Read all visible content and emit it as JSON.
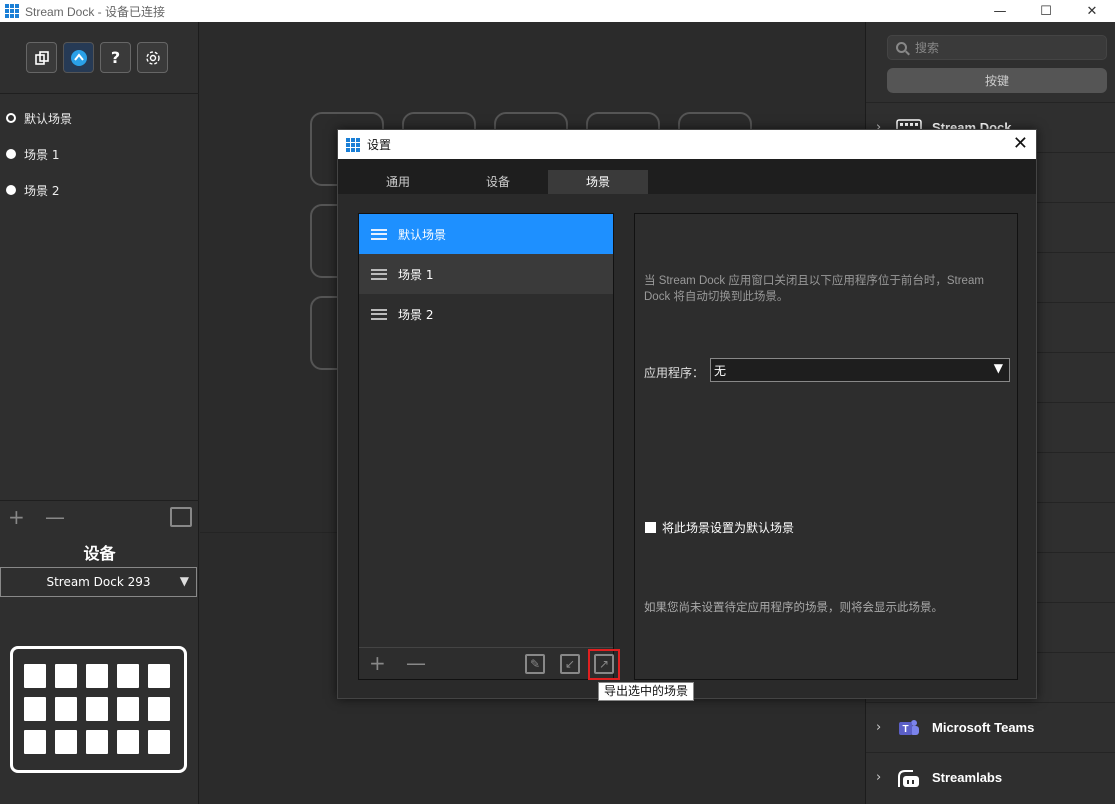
{
  "window": {
    "title": "Stream Dock - 设备已连接",
    "minimize": "—",
    "maximize": "☐",
    "close": "✕"
  },
  "toolbar": {
    "help_label": "?"
  },
  "scenes": [
    {
      "label": "默认场景",
      "active": true
    },
    {
      "label": "场景 1",
      "active": false
    },
    {
      "label": "场景 2",
      "active": false
    }
  ],
  "left_bottom": {
    "add": "+",
    "remove": "—"
  },
  "device": {
    "title": "设备",
    "selected": "Stream Dock 293",
    "key_rows": 3,
    "key_cols": 5
  },
  "right": {
    "search_placeholder": "搜索",
    "key_button": "按键",
    "categories": [
      {
        "label": "Stream Dock",
        "icon": "keyboard-icon"
      },
      {
        "label": "Microsoft Teams",
        "icon": "teams-icon",
        "color": "#5b5fc7"
      },
      {
        "label": "Streamlabs",
        "icon": "streamlabs-icon"
      }
    ]
  },
  "dialog": {
    "title": "设置",
    "close": "✕",
    "tabs": [
      {
        "label": "通用",
        "active": false
      },
      {
        "label": "设备",
        "active": false
      },
      {
        "label": "场景",
        "active": true
      }
    ],
    "scene_list": [
      {
        "label": "默认场景",
        "selected": true
      },
      {
        "label": "场景 1",
        "selected": false
      },
      {
        "label": "场景 2",
        "selected": false
      }
    ],
    "list_footer": {
      "add": "+",
      "remove": "—"
    },
    "description": "当 Stream Dock 应用窗口关闭且以下应用程序位于前台时，Stream Dock 将自动切换到此场景。",
    "app_label": "应用程序：",
    "app_value": "无",
    "default_checkbox_label": "将此场景设置为默认场景",
    "footnote": "如果您尚未设置待定应用程序的场景，则将会显示此场景。"
  },
  "tooltip": "导出选中的场景",
  "colors": {
    "accent": "#1e90ff",
    "highlight": "#e02020",
    "brand_blue": "#1a7fd6"
  }
}
